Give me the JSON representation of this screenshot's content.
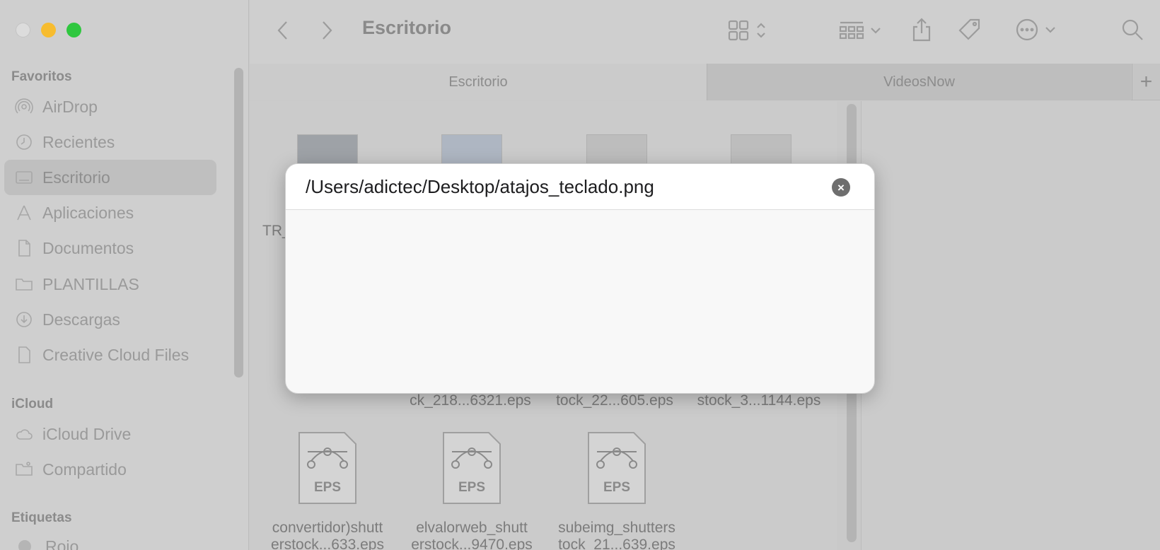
{
  "window": {
    "title": "Escritorio"
  },
  "sidebar": {
    "favorites_heading": "Favoritos",
    "favorites": [
      {
        "label": "AirDrop",
        "icon": "airdrop-icon"
      },
      {
        "label": "Recientes",
        "icon": "clock-icon"
      },
      {
        "label": "Escritorio",
        "icon": "desktop-icon",
        "selected": true
      },
      {
        "label": "Aplicaciones",
        "icon": "applications-icon"
      },
      {
        "label": "Documentos",
        "icon": "document-icon"
      },
      {
        "label": "PLANTILLAS",
        "icon": "folder-icon"
      },
      {
        "label": "Descargas",
        "icon": "download-icon"
      },
      {
        "label": "Creative Cloud Files",
        "icon": "file-icon"
      }
    ],
    "icloud_heading": "iCloud",
    "icloud": [
      {
        "label": "iCloud Drive",
        "icon": "cloud-icon"
      },
      {
        "label": "Compartido",
        "icon": "shared-folder-icon"
      }
    ],
    "tags_heading": "Etiquetas",
    "tags": [
      {
        "label": "Rojo",
        "icon": "tag-dot-icon"
      }
    ]
  },
  "tabs": [
    {
      "label": "Escritorio",
      "active": true
    },
    {
      "label": "VideosNow",
      "active": false
    }
  ],
  "tab_add_label": "+",
  "files": {
    "row1_partial_label": "TR_",
    "row2_labels": [
      "ck_218...6321.eps",
      "tock_22...605.eps",
      "stock_3...1144.eps"
    ],
    "eps_badge": "EPS",
    "row3": [
      {
        "line1": "convertidor)shutt",
        "line2": "erstock...633.eps"
      },
      {
        "line1": "elvalorweb_shutt",
        "line2": "erstock...9470.eps"
      },
      {
        "line1": "subeimg_shutters",
        "line2": "tock_21...639.eps"
      }
    ]
  },
  "goto_dialog": {
    "path_value": "/Users/adictec/Desktop/atajos_teclado.png",
    "clear_label": "×"
  }
}
